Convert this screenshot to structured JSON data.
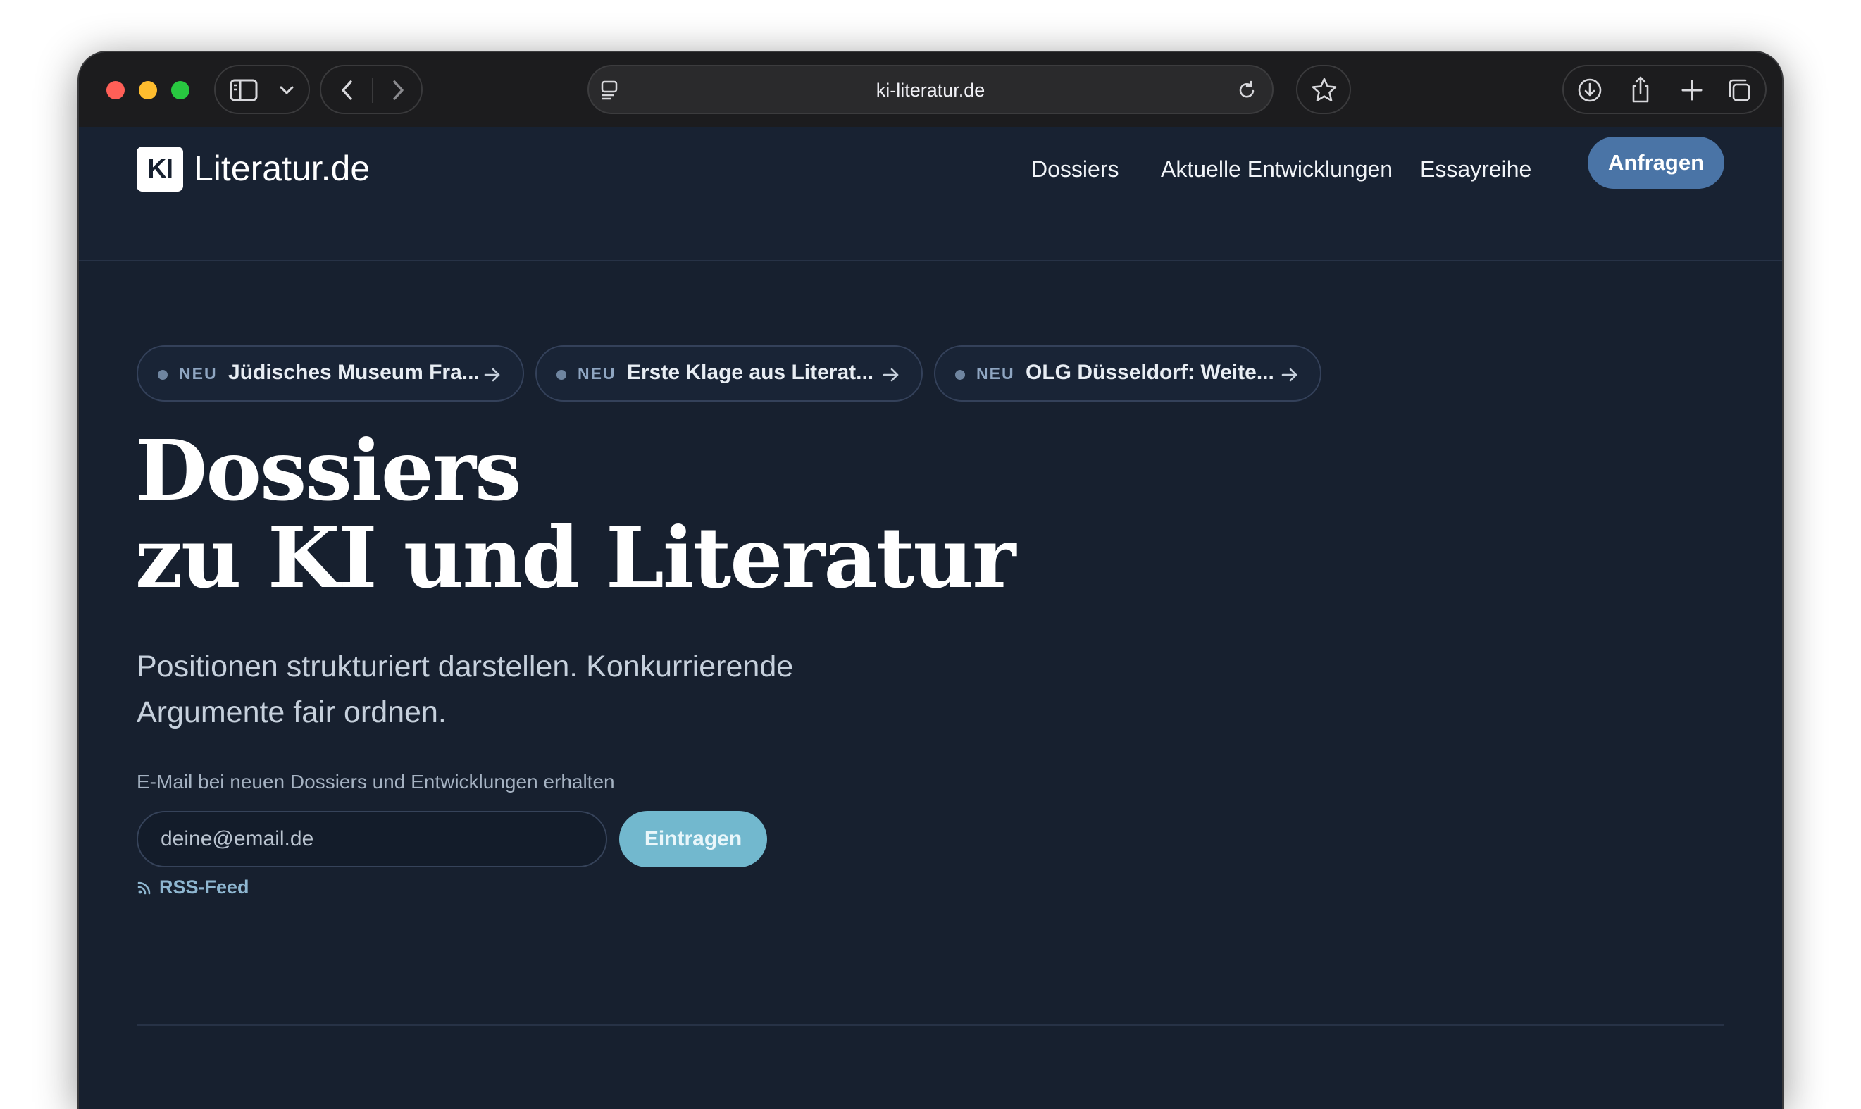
{
  "browser": {
    "url": "ki-literatur.de"
  },
  "site": {
    "logo_mark": "KI",
    "logo_text": "Literatur.de",
    "nav": [
      {
        "label": "Dossiers"
      },
      {
        "label": "Aktuelle Entwicklungen"
      },
      {
        "label": "Essayreihe"
      }
    ],
    "cta_label": "Anfragen"
  },
  "news": [
    {
      "badge": "NEU",
      "title": "Jüdisches Museum Fra..."
    },
    {
      "badge": "NEU",
      "title": "Erste Klage aus Literat..."
    },
    {
      "badge": "NEU",
      "title": "OLG Düsseldorf: Weite..."
    }
  ],
  "hero": {
    "headline_line1": "Dossiers",
    "headline_line2": "zu KI und Literatur",
    "lede": "Positionen strukturiert darstellen. Konkurrierende Argumente fair ordnen."
  },
  "newsletter": {
    "label": "E-Mail bei neuen Dossiers und Entwicklungen erhalten",
    "placeholder": "deine@email.de",
    "submit_label": "Eintragen",
    "rss_label": "RSS-Feed"
  },
  "colors": {
    "background": "#17202f",
    "accent": "#4a74a6",
    "submit": "#72b8ce"
  }
}
